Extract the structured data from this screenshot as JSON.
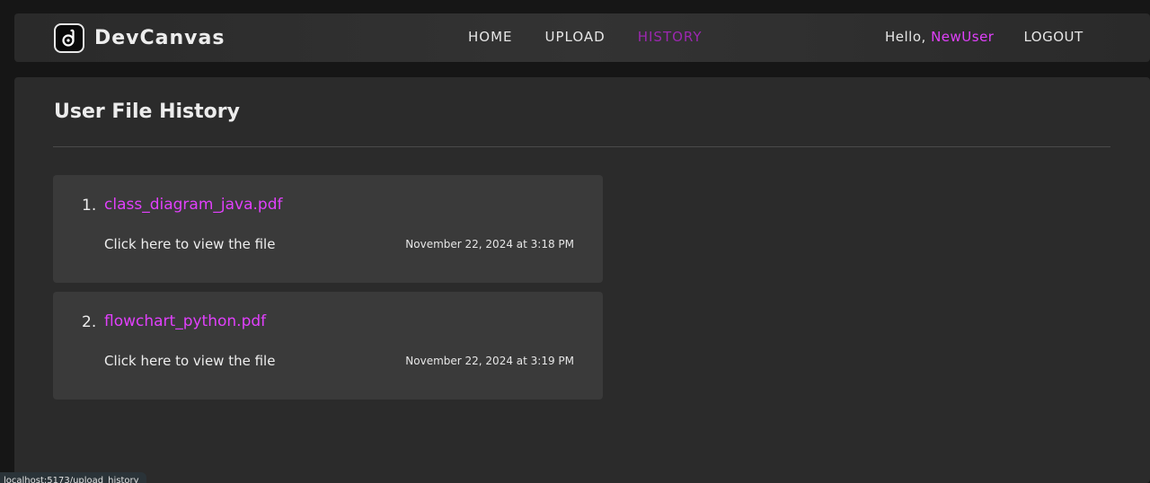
{
  "brand": {
    "name": "DevCanvas",
    "logo_icon": "devcanvas-logo-icon"
  },
  "nav": {
    "items": [
      {
        "label": "HOME",
        "active": false
      },
      {
        "label": "UPLOAD",
        "active": false
      },
      {
        "label": "HISTORY",
        "active": true
      }
    ]
  },
  "user": {
    "greeting": "Hello, ",
    "name": "NewUser",
    "logout_label": "LOGOUT"
  },
  "page": {
    "title": "User File History"
  },
  "files": [
    {
      "index": "1.",
      "name": "class_diagram_java.pdf",
      "view_label": "Click here to view the file",
      "timestamp": "November 22, 2024 at 3:18 PM"
    },
    {
      "index": "2.",
      "name": "flowchart_python.pdf",
      "view_label": "Click here to view the file",
      "timestamp": "November 22, 2024 at 3:19 PM"
    }
  ],
  "status_url": "localhost:5173/upload_history",
  "colors": {
    "accent": "#e040fb",
    "active_nav": "#9c27b0",
    "background": "#161616",
    "panel": "#2b2b2b",
    "card": "#3a3a3a"
  }
}
